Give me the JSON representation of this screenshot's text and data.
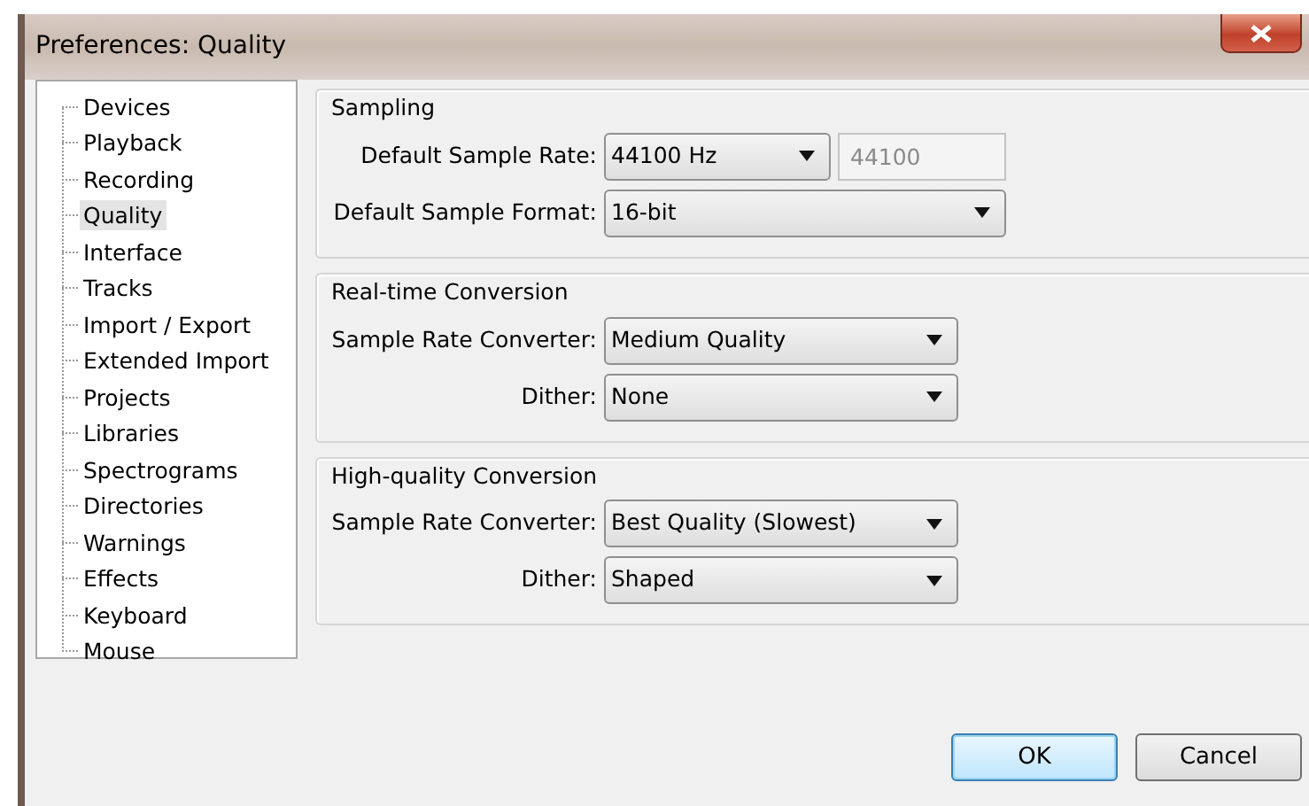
{
  "window": {
    "title": "Preferences: Quality"
  },
  "sidebar": {
    "items": [
      {
        "label": "Devices",
        "selected": false
      },
      {
        "label": "Playback",
        "selected": false
      },
      {
        "label": "Recording",
        "selected": false
      },
      {
        "label": "Quality",
        "selected": true
      },
      {
        "label": "Interface",
        "selected": false
      },
      {
        "label": "Tracks",
        "selected": false
      },
      {
        "label": "Import / Export",
        "selected": false
      },
      {
        "label": "Extended Import",
        "selected": false
      },
      {
        "label": "Projects",
        "selected": false
      },
      {
        "label": "Libraries",
        "selected": false
      },
      {
        "label": "Spectrograms",
        "selected": false
      },
      {
        "label": "Directories",
        "selected": false
      },
      {
        "label": "Warnings",
        "selected": false
      },
      {
        "label": "Effects",
        "selected": false
      },
      {
        "label": "Keyboard",
        "selected": false
      },
      {
        "label": "Mouse",
        "selected": false
      }
    ]
  },
  "groups": [
    {
      "title": "Sampling",
      "rows": [
        {
          "kind": "combo-with-field",
          "label": "Default Sample Rate:",
          "value": "44100 Hz",
          "field": {
            "value": "44100",
            "disabled": true
          }
        },
        {
          "kind": "combo",
          "label": "Default Sample Format:",
          "value": "16-bit"
        }
      ]
    },
    {
      "title": "Real-time Conversion",
      "rows": [
        {
          "kind": "combo",
          "label": "Sample Rate Converter:",
          "value": "Medium Quality"
        },
        {
          "kind": "combo",
          "label": "Dither:",
          "value": "None"
        }
      ]
    },
    {
      "title": "High-quality Conversion",
      "rows": [
        {
          "kind": "combo",
          "label": "Sample Rate Converter:",
          "value": "Best Quality (Slowest)"
        },
        {
          "kind": "combo",
          "label": "Dither:",
          "value": "Shaped"
        }
      ]
    }
  ],
  "buttons": [
    {
      "label": "OK",
      "default": true
    },
    {
      "label": "Cancel",
      "default": false
    }
  ]
}
